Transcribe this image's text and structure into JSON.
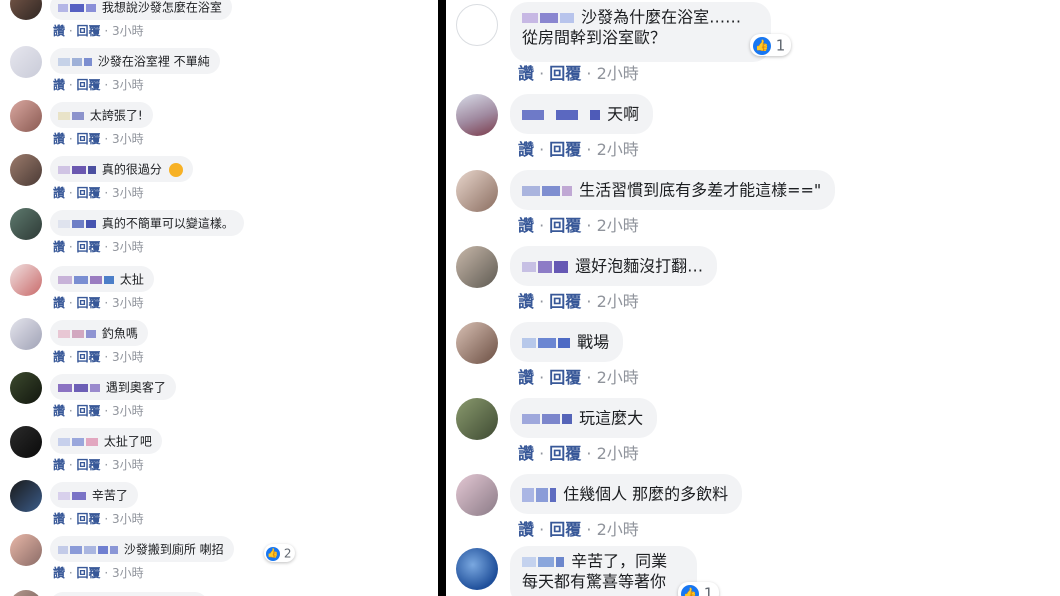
{
  "actions": {
    "like": "讚",
    "reply": "回覆",
    "dot": "·"
  },
  "left_comments": [
    {
      "text": "我想說沙發怎麼在浴室",
      "time": "3小時"
    },
    {
      "text": "沙發在浴室裡 不單純",
      "time": "3小時"
    },
    {
      "text": "太誇張了!",
      "time": "3小時"
    },
    {
      "text": "真的很過分",
      "time": "3小時"
    },
    {
      "text": "真的不簡單可以變這樣。",
      "time": "3小時"
    },
    {
      "text": "太扯",
      "time": "3小時"
    },
    {
      "text": "釣魚嗎",
      "time": "3小時"
    },
    {
      "text": "遇到奧客了",
      "time": "3小時"
    },
    {
      "text": "太扯了吧",
      "time": "3小時"
    },
    {
      "text": "辛苦了",
      "time": "3小時"
    },
    {
      "text": "沙發搬到廁所 喇招",
      "time": "3小時",
      "reactions": "2"
    }
  ],
  "right_comments": [
    {
      "line1": "沙發為什麼在浴室……",
      "line2": "從房間幹到浴室歐？",
      "time": "2小時",
      "reactions": "1"
    },
    {
      "text": "天啊",
      "time": "2小時"
    },
    {
      "text": "生活習慣到底有多差才能這樣==\"",
      "time": "2小時"
    },
    {
      "text": "還好泡麵沒打翻…",
      "time": "2小時"
    },
    {
      "text": "戰場",
      "time": "2小時"
    },
    {
      "text": "玩這麼大",
      "time": "2小時"
    },
    {
      "text": "住幾個人 那麼的多飲料",
      "time": "2小時"
    },
    {
      "line1": "辛苦了，同業",
      "line2": "每天都有驚喜等著你",
      "reactions": "1"
    }
  ],
  "colors": {
    "link": "#385898",
    "meta": "#90949c",
    "bubble": "#f2f3f5",
    "like": "#1877f2"
  },
  "icons": {
    "like": "thumbs-up-icon",
    "angry": "angry-emoji-icon"
  }
}
